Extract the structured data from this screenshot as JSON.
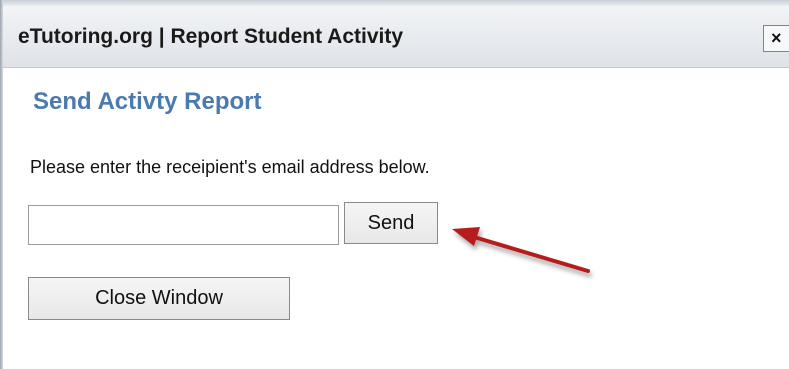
{
  "window": {
    "title": "eTutoring.org | Report Student Activity",
    "close_label": "×"
  },
  "dialog": {
    "heading": "Send Activty Report",
    "instruction": "Please enter the receipient's email address below.",
    "email_value": "",
    "send_label": "Send",
    "close_window_label": "Close Window"
  },
  "annotation": {
    "arrow_color": "#b51c1c"
  }
}
